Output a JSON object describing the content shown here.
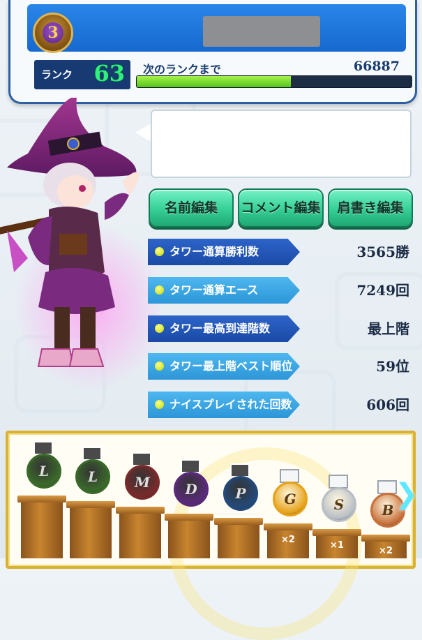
{
  "header": {
    "badge_number": "3",
    "rank_label": "ランク",
    "rank_value": "63",
    "next_rank_label": "次のランクまで",
    "next_rank_value": "66887",
    "xp_progress_percent": 56
  },
  "buttons": {
    "edit_name": "名前編集",
    "edit_comment": "コメント編集",
    "edit_title": "肩書き編集"
  },
  "stats": [
    {
      "label": "タワー通算勝利数",
      "value": "3565勝"
    },
    {
      "label": "タワー通算エース",
      "value": "7249回"
    },
    {
      "label": "タワー最高到達階数",
      "value": "最上階"
    },
    {
      "label": "タワー最上階ベスト順位",
      "value": "59位"
    },
    {
      "label": "ナイスプレイされた回数",
      "value": "606回"
    }
  ],
  "medals": [
    {
      "letter": "L",
      "count": "",
      "color": "#3a6a2a"
    },
    {
      "letter": "L",
      "count": "",
      "color": "#3a6a2a"
    },
    {
      "letter": "M",
      "count": "",
      "color": "#7a2a2a"
    },
    {
      "letter": "D",
      "count": "",
      "color": "#5a2a7a"
    },
    {
      "letter": "P",
      "count": "",
      "color": "#234a7a"
    },
    {
      "letter": "G",
      "count": "×2",
      "color": "#e6a21a"
    },
    {
      "letter": "S",
      "count": "×1",
      "color": "#b8bec5"
    },
    {
      "letter": "B",
      "count": "×2",
      "color": "#c7703a"
    }
  ],
  "colors": {
    "accent_blue": "#1669cf",
    "button_green": "#35cf95",
    "xp_green": "#56c41a",
    "medal_border": "#d9b232"
  },
  "icons": {
    "rank_badge": "rank-badge-icon",
    "tennis_ball": "tennis-ball-icon",
    "next_arrow": "chevron-right-icon"
  }
}
